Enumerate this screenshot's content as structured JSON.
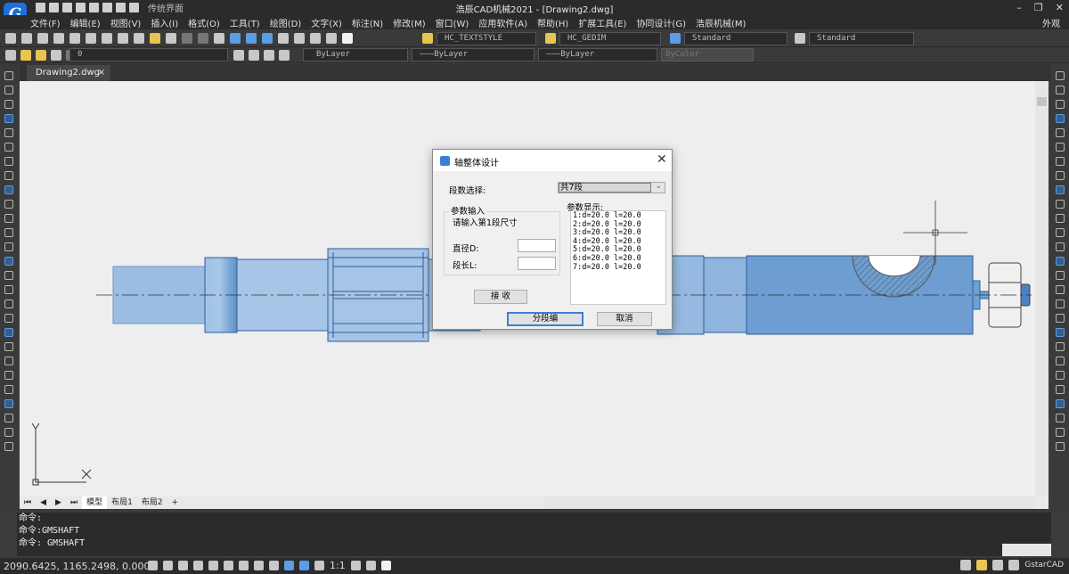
{
  "app": {
    "title": "浩辰CAD机械2021 - [Drawing2.dwg]",
    "logo_letter": "G",
    "workspace": "传统界面",
    "appearance_menu": "外观",
    "window_controls": {
      "minimize": "–",
      "restore": "❐",
      "close": "✕"
    }
  },
  "menu": [
    "文件(F)",
    "编辑(E)",
    "视图(V)",
    "插入(I)",
    "格式(O)",
    "工具(T)",
    "绘图(D)",
    "文字(X)",
    "标注(N)",
    "修改(M)",
    "窗口(W)",
    "应用软件(A)",
    "帮助(H)",
    "扩展工具(E)",
    "协同设计(G)",
    "浩辰机械(M)"
  ],
  "toolbar": {
    "text_style": "HC_TEXTSTYLE",
    "dim_style": "HC_GEDIM",
    "table_style": "Standard",
    "multileader_style": "Standard",
    "layer": "0",
    "color": "ByLayer",
    "linetype": "———ByLayer",
    "lineweight": "———ByLayer",
    "plotstyle": "ByColor"
  },
  "document_tab": {
    "label": "Drawing2.dwg",
    "close": "×"
  },
  "layout_tabs": [
    "模型",
    "布局1",
    "布局2",
    "+"
  ],
  "ucs": {
    "x": "X",
    "y": "Y"
  },
  "command_lines": [
    "命令:",
    "命令:GMSHAFT",
    "命令: GMSHAFT"
  ],
  "status": {
    "coords": "2090.6425, 1165.2498, 0.0000",
    "scale": "1:1",
    "brand": "GstarCAD"
  },
  "dialog": {
    "title": "轴整体设计",
    "segments_label": "段数选择:",
    "segments_value": "共7段",
    "input_group": "参数输入",
    "prompt": "请输入第1段尺寸",
    "diameter_label": "直径D:",
    "length_label": "段长L:",
    "diameter_value": "",
    "length_value": "",
    "display_label": "参数显示:",
    "params": [
      "1:d=20.0  l=20.0",
      "2:d=20.0  l=20.0",
      "3:d=20.0  l=20.0",
      "4:d=20.0  l=20.0",
      "5:d=20.0  l=20.0",
      "6:d=20.0  l=20.0",
      "7:d=20.0  l=20.0"
    ],
    "accept": "接 收",
    "segment_edit": "分段编",
    "cancel": "取消"
  },
  "colors": {
    "accent": "#1e6fd9",
    "canvas": "#eeeef0",
    "shaft_fill": "#8fb6df",
    "shaft_stroke": "#2f5f9a"
  }
}
